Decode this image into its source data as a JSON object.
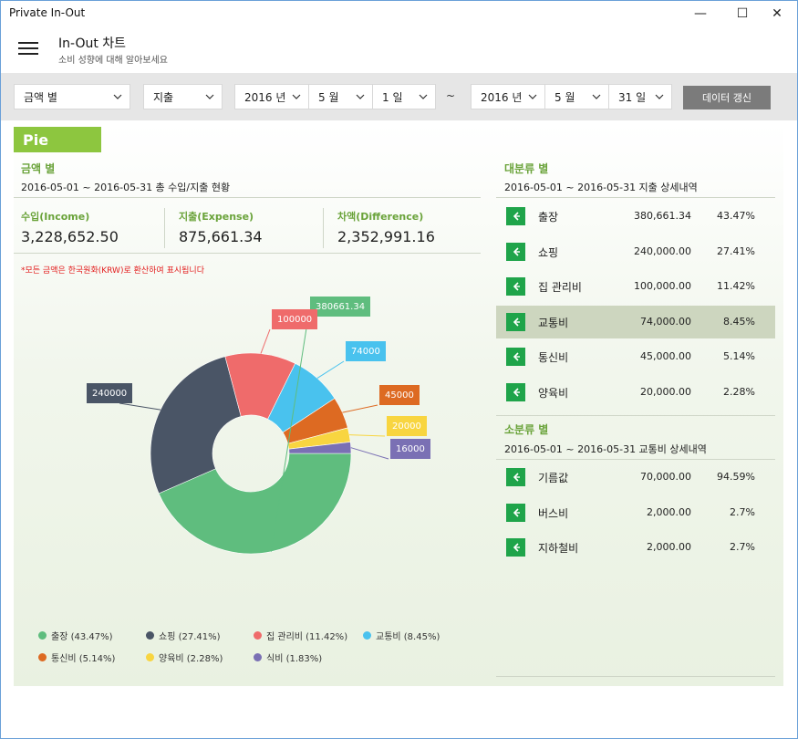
{
  "window": {
    "title": "Private In-Out",
    "minimize_glyph": "—",
    "maximize_glyph": "☐",
    "close_glyph": "✕"
  },
  "header": {
    "title": "In-Out 차트",
    "subtitle": "소비 성향에 대해 알아보세요",
    "menu_icon": "hamburger-icon"
  },
  "filters": {
    "mode": "금액 별",
    "type": "지출",
    "start": {
      "year": "2016 년",
      "month": "5 월",
      "day": "1 일"
    },
    "separator": "~",
    "end": {
      "year": "2016 년",
      "month": "5 월",
      "day": "31 일"
    },
    "refresh_label": "데이터 갱신"
  },
  "tab": {
    "label": "Pie"
  },
  "left": {
    "heading": "금액 별",
    "subheading": "2016-05-01 ~ 2016-05-31 총 수입/지출 현황",
    "income_label": "수입(Income)",
    "income_value": "3,228,652.50",
    "expense_label": "지출(Expense)",
    "expense_value": "875,661.34",
    "diff_label": "차액(Difference)",
    "diff_value": "2,352,991.16",
    "notice": "*모든 금액은 한국원화(KRW)로 환산하여 표시됩니다"
  },
  "colors": {
    "accent": "#6aa33a",
    "tab_green": "#8dc63f",
    "button_green": "#1fa44a",
    "selected_row": "#cdd6bf"
  },
  "chart_data": {
    "type": "pie",
    "style": "donut",
    "slices": [
      {
        "name": "출장",
        "value": 380661.34,
        "label": "380661.34",
        "legend": "출장 (43.47%)",
        "color": "#5fbd7e"
      },
      {
        "name": "쇼핑",
        "value": 240000,
        "label": "240000",
        "legend": "쇼핑 (27.41%)",
        "color": "#4a5566"
      },
      {
        "name": "집 관리비",
        "value": 100000,
        "label": "100000",
        "legend": "집 관리비 (11.42%)",
        "color": "#ef6b6b"
      },
      {
        "name": "교통비",
        "value": 74000,
        "label": "74000",
        "legend": "교통비 (8.45%)",
        "color": "#49c2ee"
      },
      {
        "name": "통신비",
        "value": 45000,
        "label": "45000",
        "legend": "통신비 (5.14%)",
        "color": "#dd6a22"
      },
      {
        "name": "양육비",
        "value": 20000,
        "label": "20000",
        "legend": "양육비 (2.28%)",
        "color": "#f8d540"
      },
      {
        "name": "식비",
        "value": 16000,
        "label": "16000",
        "legend": "식비 (1.83%)",
        "color": "#7a70b4"
      }
    ],
    "legend_placement": "bottom"
  },
  "category_major": {
    "heading": "대분류 별",
    "subheading": "2016-05-01 ~ 2016-05-31 지출 상세내역",
    "rows": [
      {
        "name": "출장",
        "amount": "380,661.34",
        "pct": "43.47%"
      },
      {
        "name": "쇼핑",
        "amount": "240,000.00",
        "pct": "27.41%"
      },
      {
        "name": "집 관리비",
        "amount": "100,000.00",
        "pct": "11.42%"
      },
      {
        "name": "교통비",
        "amount": "74,000.00",
        "pct": "8.45%"
      },
      {
        "name": "통신비",
        "amount": "45,000.00",
        "pct": "5.14%"
      },
      {
        "name": "양육비",
        "amount": "20,000.00",
        "pct": "2.28%"
      }
    ],
    "selected": "교통비"
  },
  "category_minor": {
    "heading": "소분류 별",
    "subheading": "2016-05-01 ~ 2016-05-31 교통비 상세내역",
    "rows": [
      {
        "name": "기름값",
        "amount": "70,000.00",
        "pct": "94.59%"
      },
      {
        "name": "버스비",
        "amount": "2,000.00",
        "pct": "2.7%"
      },
      {
        "name": "지하철비",
        "amount": "2,000.00",
        "pct": "2.7%"
      }
    ]
  }
}
